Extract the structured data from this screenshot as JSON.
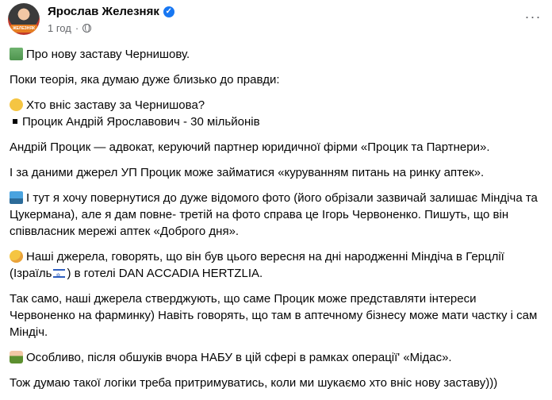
{
  "author": {
    "name": "Ярослав Железняк",
    "time": "1 год",
    "verified_icon": "verified-check-icon",
    "privacy_icon": "globe-icon",
    "avatar_badge": "ЖЕЛЕЗНЯК"
  },
  "menu_icon": "more-options-icon",
  "post": {
    "p1": "Про нову заставу Чернишову.",
    "p2": "Поки теорія, яка думаю дуже близько до правди:",
    "p3a": "Хто вніс заставу за Чернишова?",
    "p3b": "Процик Андрій Ярославович - 30 мільйонів",
    "p4": "Андрій Процик — адвокат, керуючий партнер юридичної фірми «Процик та Партнери».",
    "p5": "І за даними джерел УП  Процик може займатися «куруванням питань на ринку аптек».",
    "p6": "І тут я хочу повернутися до дуже відомого фото (його обрізали зазвичай залишає Міндіча та Цукермана), але я дам повне- третій на фото справа це Ігорь Червоненко. Пишуть, що він співвласник мережі аптек «Доброго дня».",
    "p7a": "Наші джерела, говорять, що він був цього вересня на дні народженні Міндіча в Герцлії (Ізраїль",
    "p7b": ") в готелі DAN ACCADIA HERTZLIA.",
    "p8": "Так само, наші джерела стверджують, що саме Процик може представляти інтереси Червоненко на фарминку) Навіть говорять, що там в аптечному бізнесу може мати частку і сам Міндіч.",
    "p9": "Особливо, після обшуків вчора НАБУ в цій сфері в рамках операції' «Мідас».",
    "p10": "Тож думаю такої логіки треба притримуватись, коли ми шукаємо хто вніс нову заставу)))"
  }
}
